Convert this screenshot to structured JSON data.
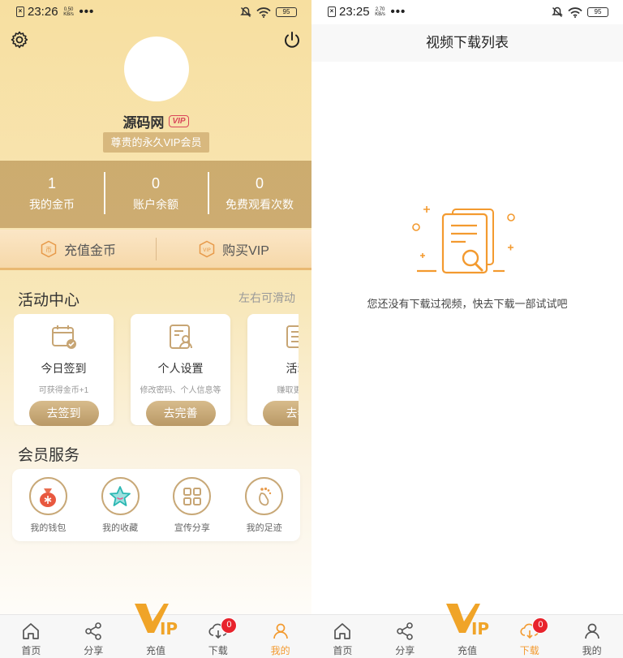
{
  "left": {
    "status": {
      "time": "23:26",
      "speed_value": "0.50",
      "speed_unit": "KB/s",
      "dots": "•••",
      "battery": "95"
    },
    "profile": {
      "username": "源码网",
      "vip_tag": "VIP",
      "member_badge": "尊贵的永久VIP会员"
    },
    "stats": [
      {
        "value": "1",
        "label": "我的金币"
      },
      {
        "value": "0",
        "label": "账户余额"
      },
      {
        "value": "0",
        "label": "免费观看次数"
      }
    ],
    "actions": {
      "recharge": {
        "label": "充值金币",
        "icon_text": "币"
      },
      "buy_vip": {
        "label": "购买VIP",
        "icon_text": "VIP"
      }
    },
    "activity": {
      "title": "活动中心",
      "hint": "左右可滑动",
      "cards": [
        {
          "title": "今日签到",
          "sub": "可获得金币+1",
          "button": "去签到"
        },
        {
          "title": "个人设置",
          "sub": "修改密码、个人信息等",
          "button": "去完善"
        },
        {
          "title": "活动",
          "sub": "赚取更多的",
          "button": "去参"
        }
      ]
    },
    "services": {
      "title": "会员服务",
      "items": [
        {
          "label": "我的钱包"
        },
        {
          "label": "我的收藏"
        },
        {
          "label": "宣传分享"
        },
        {
          "label": "我的足迹"
        }
      ]
    }
  },
  "right": {
    "status": {
      "time": "23:25",
      "speed_value": "2.70",
      "speed_unit": "KB/s",
      "dots": "•••",
      "battery": "95"
    },
    "title": "视频下载列表",
    "empty_text": "您还没有下载过视频，快去下载一部试试吧"
  },
  "nav": {
    "items": [
      {
        "label": "首页",
        "icon": "home-icon"
      },
      {
        "label": "分享",
        "icon": "share-icon"
      },
      {
        "label": "充值",
        "icon": "vip-logo-icon"
      },
      {
        "label": "下载",
        "icon": "download-icon",
        "badge": "0"
      },
      {
        "label": "我的",
        "icon": "user-icon"
      }
    ]
  },
  "colors": {
    "accent": "#f39a2f",
    "gold": "#c8a877",
    "badge": "#e8232c"
  }
}
